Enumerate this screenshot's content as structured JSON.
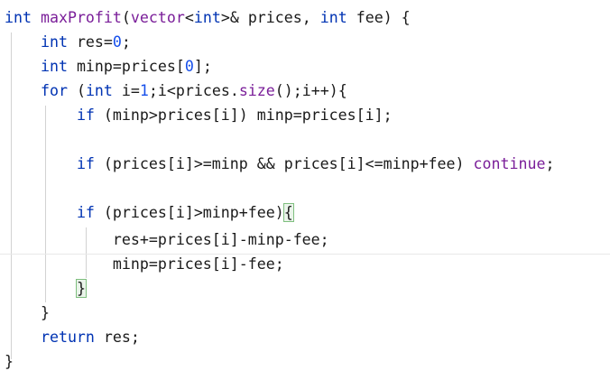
{
  "code": {
    "lines": [
      {
        "segments": [
          {
            "t": "int",
            "c": "kw"
          },
          {
            "t": " ",
            "c": "plain"
          },
          {
            "t": "maxProfit",
            "c": "fn"
          },
          {
            "t": "(",
            "c": "plain"
          },
          {
            "t": "vector",
            "c": "fn"
          },
          {
            "t": "<",
            "c": "plain"
          },
          {
            "t": "int",
            "c": "kw"
          },
          {
            "t": ">& prices, ",
            "c": "plain"
          },
          {
            "t": "int",
            "c": "kw"
          },
          {
            "t": " fee) {",
            "c": "plain"
          }
        ]
      },
      {
        "segments": [
          {
            "t": "    ",
            "c": "plain"
          },
          {
            "t": "int",
            "c": "kw"
          },
          {
            "t": " res=",
            "c": "plain"
          },
          {
            "t": "0",
            "c": "num"
          },
          {
            "t": ";",
            "c": "plain"
          }
        ]
      },
      {
        "segments": [
          {
            "t": "    ",
            "c": "plain"
          },
          {
            "t": "int",
            "c": "kw"
          },
          {
            "t": " minp=prices[",
            "c": "plain"
          },
          {
            "t": "0",
            "c": "num"
          },
          {
            "t": "];",
            "c": "plain"
          }
        ]
      },
      {
        "segments": [
          {
            "t": "    ",
            "c": "plain"
          },
          {
            "t": "for",
            "c": "kw"
          },
          {
            "t": " (",
            "c": "plain"
          },
          {
            "t": "int",
            "c": "kw"
          },
          {
            "t": " i=",
            "c": "plain"
          },
          {
            "t": "1",
            "c": "num"
          },
          {
            "t": ";i<prices.",
            "c": "plain"
          },
          {
            "t": "size",
            "c": "fn"
          },
          {
            "t": "();i++){",
            "c": "plain"
          }
        ]
      },
      {
        "segments": [
          {
            "t": "        ",
            "c": "plain"
          },
          {
            "t": "if",
            "c": "kw"
          },
          {
            "t": " (minp>prices[i]) minp=prices[i];",
            "c": "plain"
          }
        ]
      },
      {
        "segments": []
      },
      {
        "segments": [
          {
            "t": "        ",
            "c": "plain"
          },
          {
            "t": "if",
            "c": "kw"
          },
          {
            "t": " (prices[i]>=minp && prices[i]<=minp+fee) ",
            "c": "plain"
          },
          {
            "t": "continue",
            "c": "fn"
          },
          {
            "t": ";",
            "c": "plain"
          }
        ]
      },
      {
        "segments": []
      },
      {
        "segments": [
          {
            "t": "        ",
            "c": "plain"
          },
          {
            "t": "if",
            "c": "kw"
          },
          {
            "t": " (prices[i]>minp+fee)",
            "c": "plain"
          },
          {
            "t": "{",
            "c": "brace"
          }
        ]
      },
      {
        "segments": [
          {
            "t": "            res+=prices[i]-minp-fee;",
            "c": "plain"
          }
        ]
      },
      {
        "segments": [
          {
            "t": "            minp=prices[i]-fee;",
            "c": "plain"
          }
        ]
      },
      {
        "segments": [
          {
            "t": "        ",
            "c": "plain"
          },
          {
            "t": "}",
            "c": "brace"
          }
        ]
      },
      {
        "segments": [
          {
            "t": "    }",
            "c": "plain"
          }
        ]
      },
      {
        "segments": [
          {
            "t": "    ",
            "c": "plain"
          },
          {
            "t": "return",
            "c": "kw"
          },
          {
            "t": " res;",
            "c": "plain"
          }
        ]
      },
      {
        "segments": [
          {
            "t": "}",
            "c": "plain"
          }
        ]
      }
    ]
  },
  "colors": {
    "keyword": "#0033b3",
    "function": "#7a1e99",
    "number": "#1750eb",
    "text": "#1a1a1a",
    "indent_guide": "#d2d2d2",
    "brace_match": "#7fbf7f"
  }
}
